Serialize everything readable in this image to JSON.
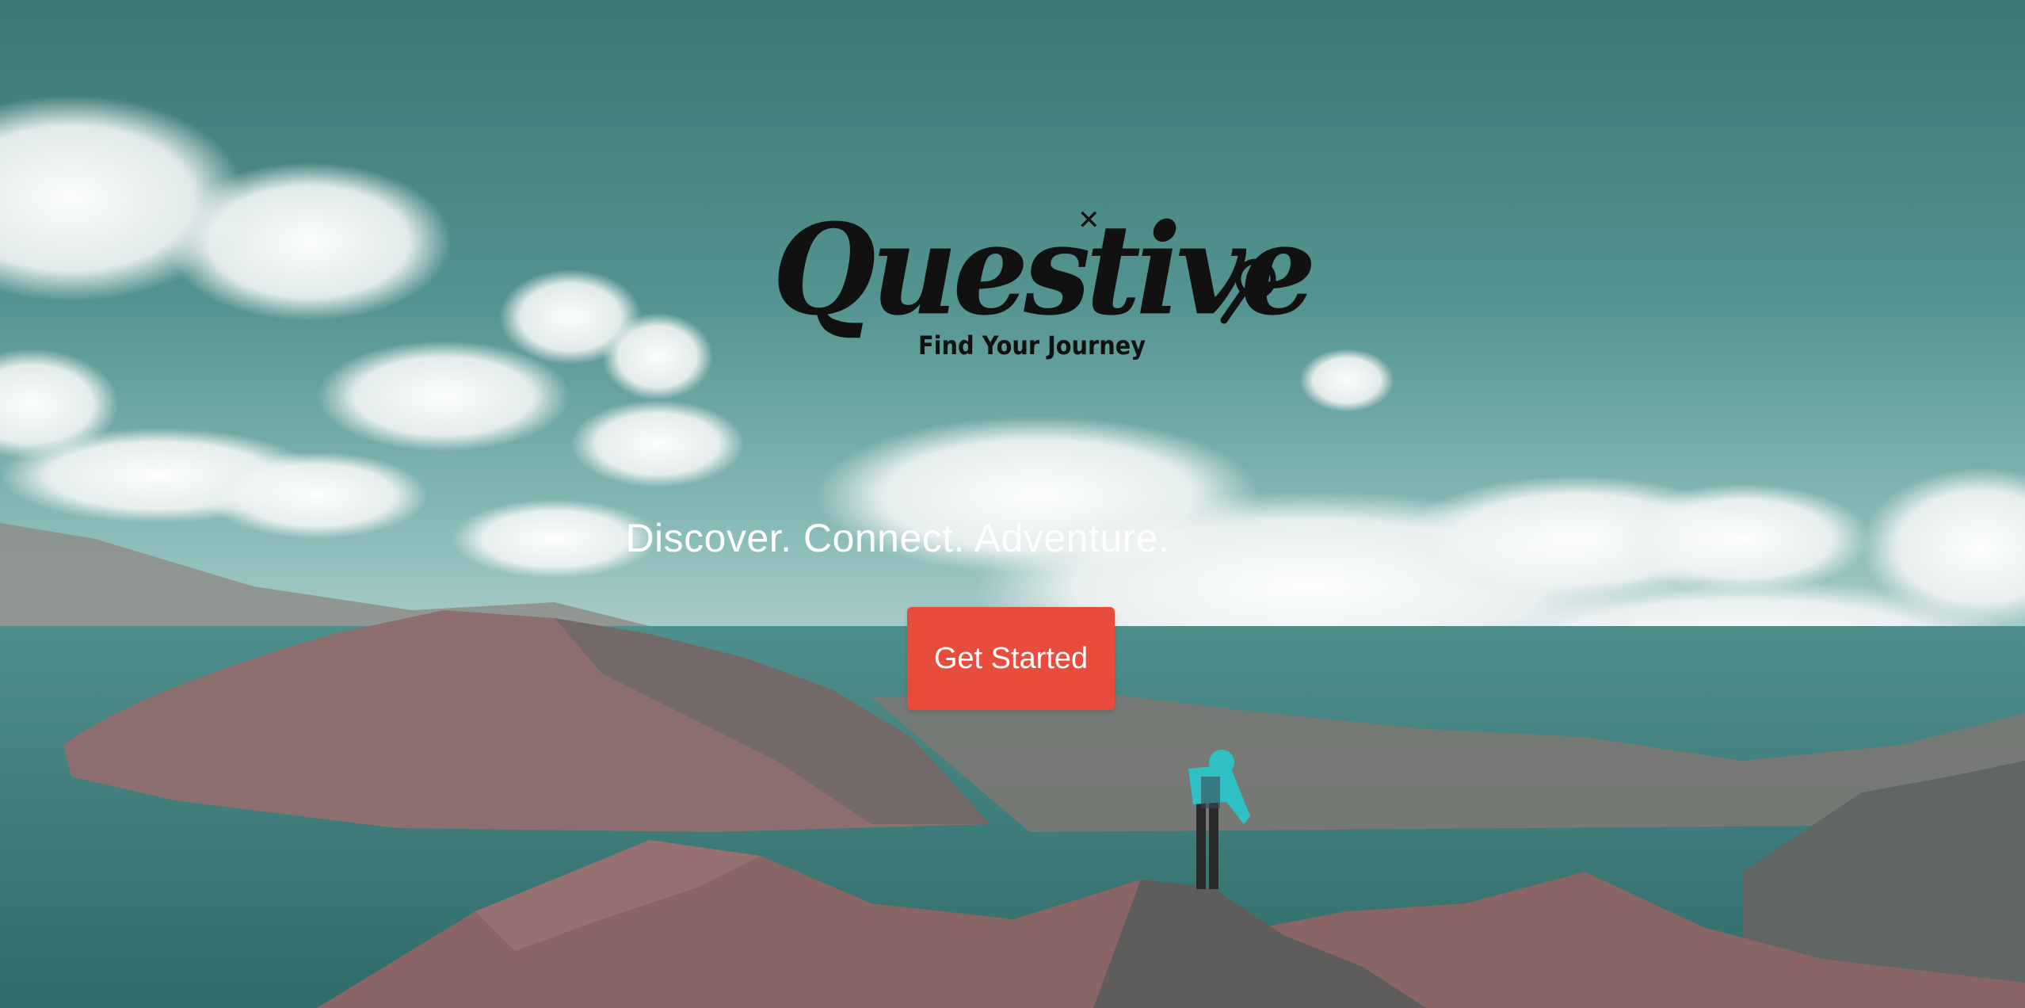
{
  "hero": {
    "logo_text": "Questive",
    "logo_tagline": "Find Your Journey",
    "headline": "Discover. Connect. Adventure.",
    "cta_label": "Get Started",
    "cta_color": "#e84c3d",
    "background_scene": "mountain-lake-hiker-photo"
  }
}
